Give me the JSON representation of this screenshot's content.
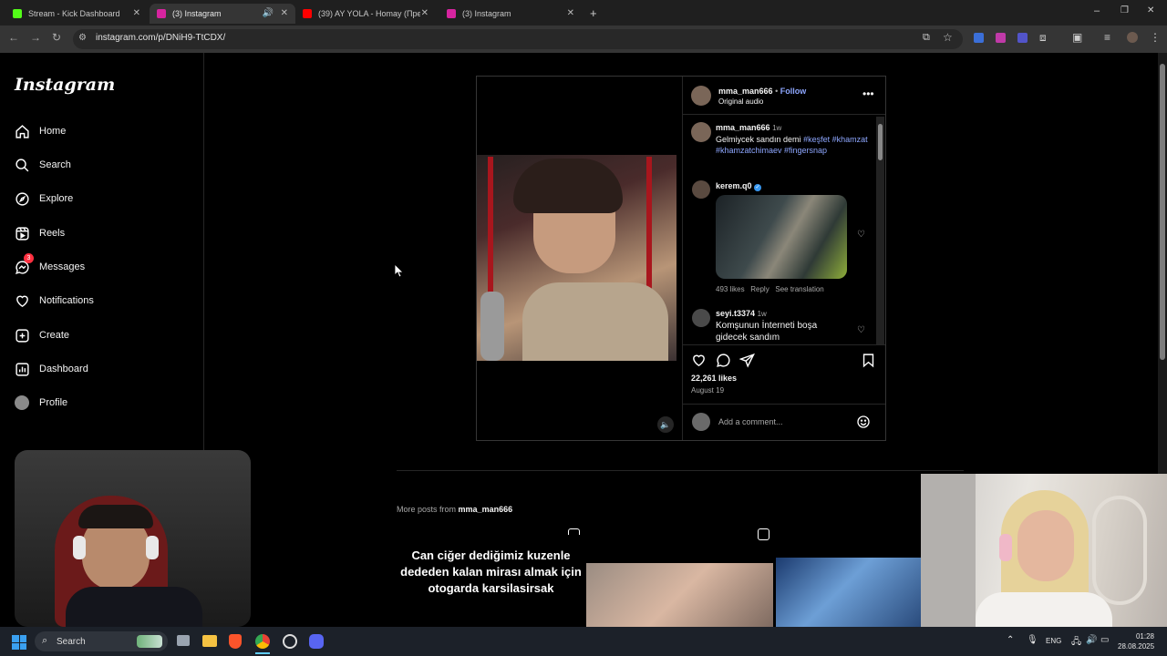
{
  "browser": {
    "tabs": [
      {
        "title": "Stream - Kick Dashboard",
        "color": "#53fc18"
      },
      {
        "title": "(3) Instagram",
        "color": "#d6249f"
      },
      {
        "title": "(39) AY YOLA - Homay (Пресм...",
        "color": "#ff0000"
      },
      {
        "title": "(3) Instagram",
        "color": "#d6249f"
      }
    ],
    "url": "instagram.com/p/DNiH9-TtCDX/"
  },
  "instagram": {
    "logo": "Instagram",
    "nav": [
      {
        "label": "Home",
        "icon": "home-icon"
      },
      {
        "label": "Search",
        "icon": "search-icon"
      },
      {
        "label": "Explore",
        "icon": "compass-icon"
      },
      {
        "label": "Reels",
        "icon": "reels-icon"
      },
      {
        "label": "Messages",
        "icon": "messenger-icon",
        "badge": "3"
      },
      {
        "label": "Notifications",
        "icon": "heart-icon"
      },
      {
        "label": "Create",
        "icon": "plus-square-icon"
      },
      {
        "label": "Dashboard",
        "icon": "chart-icon"
      },
      {
        "label": "Profile",
        "icon": "avatar-icon"
      }
    ],
    "post": {
      "username": "mma_man666",
      "follow": "Follow",
      "separator": "•",
      "audio": "Original audio",
      "caption": {
        "username": "mma_man666",
        "time": "1w",
        "text": "Gelmiycek sandın demi",
        "tags": "#keşfet #khamzat #khamzatchimaev #fingersnap"
      },
      "comments": [
        {
          "username": "kerem.q0",
          "verified": true,
          "likes": "493 likes",
          "reply": "Reply",
          "translation": "See translation"
        },
        {
          "username": "seyi.t3374",
          "time": "1w",
          "text": "Komşunun İnterneti boşa gidecek sandım"
        }
      ],
      "likes": "22,261 likes",
      "date": "August 19",
      "add_comment_placeholder": "Add a comment..."
    },
    "more_posts": {
      "prefix": "More posts from",
      "username": "mma_man666"
    },
    "grid": [
      {
        "caption": "Can ciğer dediğimiz kuzenle dededen kalan mirası almak için otogarda karsilasirsak"
      },
      {
        "caption": ""
      },
      {
        "caption": ""
      }
    ]
  },
  "taskbar": {
    "search": "Search",
    "lang": "ENG",
    "time": "01:28",
    "date": "28.08.2025"
  }
}
